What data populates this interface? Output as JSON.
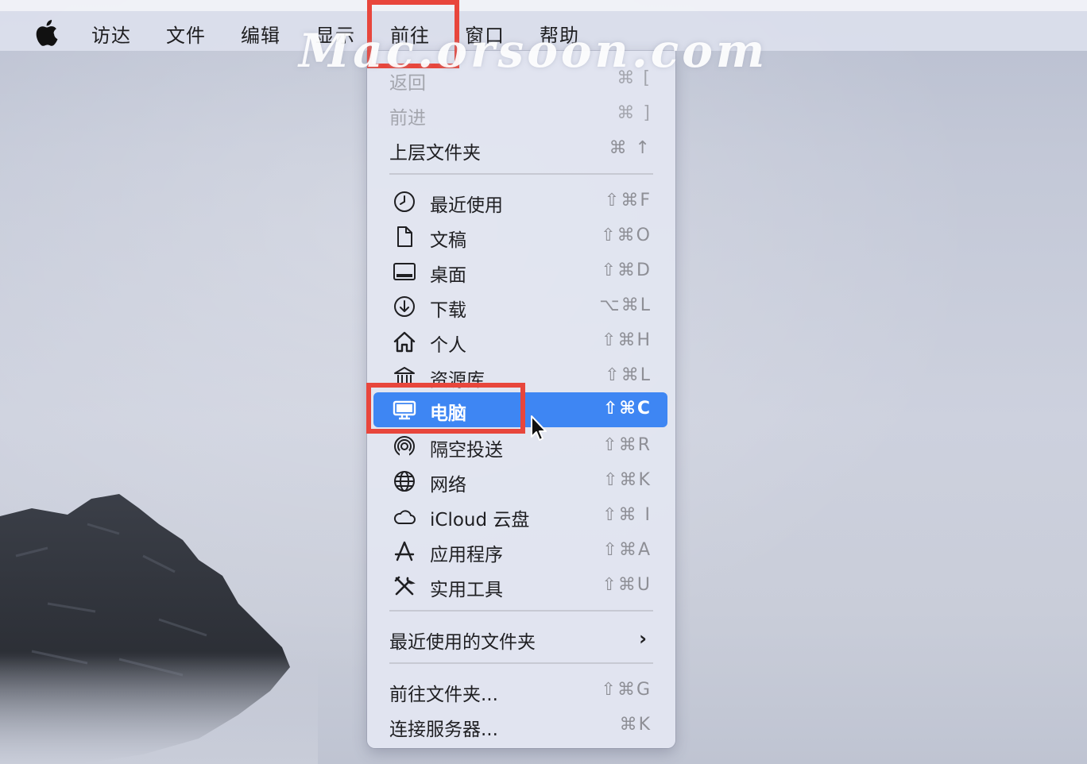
{
  "menubar": {
    "items": [
      {
        "label": "访达"
      },
      {
        "label": "文件"
      },
      {
        "label": "编辑"
      },
      {
        "label": "显示"
      },
      {
        "label": "前往"
      },
      {
        "label": "窗口"
      },
      {
        "label": "帮助"
      }
    ],
    "active": "前往"
  },
  "watermark": "Mac.orsoon.com",
  "menu": {
    "nav": [
      {
        "label": "返回",
        "shortcut": "⌘ [",
        "disabled": true
      },
      {
        "label": "前进",
        "shortcut": "⌘ ]",
        "disabled": true
      },
      {
        "label": "上层文件夹",
        "shortcut": "⌘ ↑",
        "disabled": false
      }
    ],
    "places": [
      {
        "label": "最近使用",
        "shortcut": "⇧⌘F",
        "icon": "clock-icon"
      },
      {
        "label": "文稿",
        "shortcut": "⇧⌘O",
        "icon": "document-icon"
      },
      {
        "label": "桌面",
        "shortcut": "⇧⌘D",
        "icon": "desktop-icon"
      },
      {
        "label": "下载",
        "shortcut": "⌥⌘L",
        "icon": "download-icon"
      },
      {
        "label": "个人",
        "shortcut": "⇧⌘H",
        "icon": "home-icon"
      },
      {
        "label": "资源库",
        "shortcut": "⇧⌘L",
        "icon": "library-icon"
      },
      {
        "label": "电脑",
        "shortcut": "⇧⌘C",
        "icon": "computer-icon",
        "selected": true
      },
      {
        "label": "隔空投送",
        "shortcut": "⇧⌘R",
        "icon": "airdrop-icon"
      },
      {
        "label": "网络",
        "shortcut": "⇧⌘K",
        "icon": "network-icon"
      },
      {
        "label": "iCloud 云盘",
        "shortcut": "⇧⌘ I",
        "icon": "cloud-icon"
      },
      {
        "label": "应用程序",
        "shortcut": "⇧⌘A",
        "icon": "applications-icon"
      },
      {
        "label": "实用工具",
        "shortcut": "⇧⌘U",
        "icon": "utilities-icon"
      }
    ],
    "recent_folders": {
      "label": "最近使用的文件夹",
      "chevron": "›"
    },
    "go_folder": {
      "label": "前往文件夹...",
      "shortcut": "⇧⌘G"
    },
    "connect_server": {
      "label": "连接服务器...",
      "shortcut": "⌘K"
    }
  },
  "colors": {
    "highlight": "#3e86f3",
    "annotation_red": "#e8463c"
  }
}
